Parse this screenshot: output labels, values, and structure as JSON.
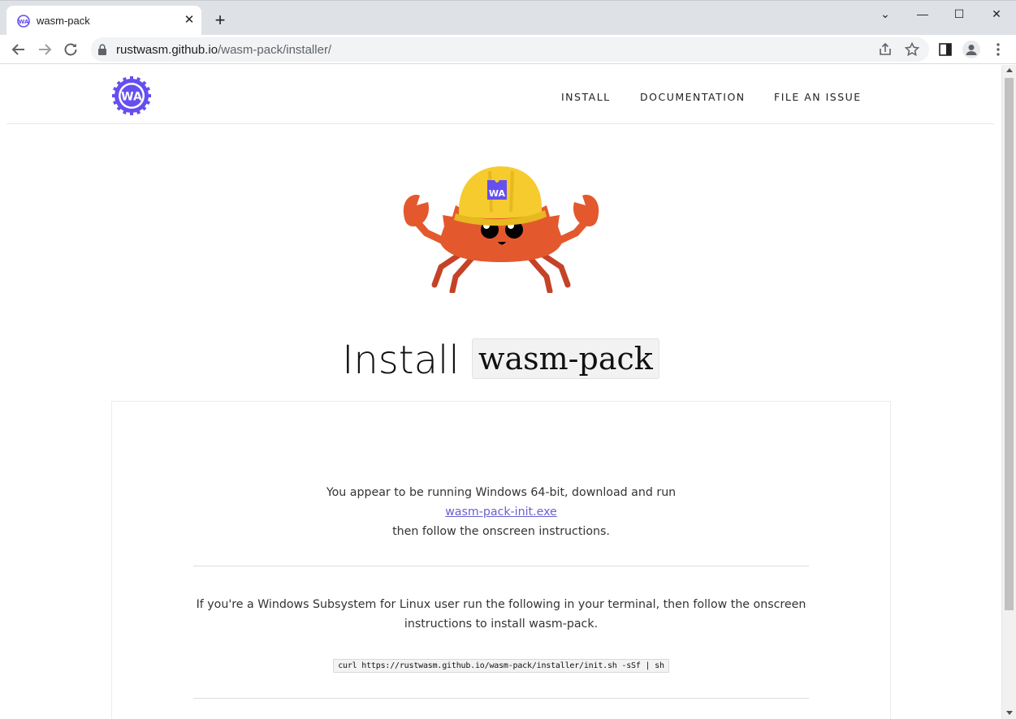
{
  "browser": {
    "tab_title": "wasm-pack",
    "tab_close": "✕",
    "new_tab": "+",
    "url_host": "rustwasm.github.io",
    "url_path": "/wasm-pack/installer/",
    "window_controls": {
      "minimize": "—",
      "maximize": "☐",
      "close": "✕",
      "tab_search": "⌄"
    }
  },
  "header": {
    "logo_icon": "wasm-pack-logo",
    "nav": [
      "INSTALL",
      "DOCUMENTATION",
      "FILE AN ISSUE"
    ]
  },
  "hero": {
    "mascot_icon": "ferris-crab-with-wa-hardhat",
    "mascot_hat_text": "WA",
    "title_prefix": "Install",
    "title_code": "wasm-pack"
  },
  "installer": {
    "windows_line1": "You appear to be running Windows 64-bit, download and run",
    "windows_link": "wasm-pack-init.exe",
    "windows_line3": "then follow the onscreen instructions.",
    "wsl_text": "If you're a Windows Subsystem for Linux user run the following in your terminal, then follow the onscreen instructions to install wasm-pack.",
    "wsl_command": "curl https://rustwasm.github.io/wasm-pack/installer/init.sh -sSf | sh"
  },
  "colors": {
    "wasm_purple": "#654ff0",
    "crab_orange": "#e4582e",
    "hat_yellow": "#f5cb2e",
    "link": "#6b5fd0"
  }
}
